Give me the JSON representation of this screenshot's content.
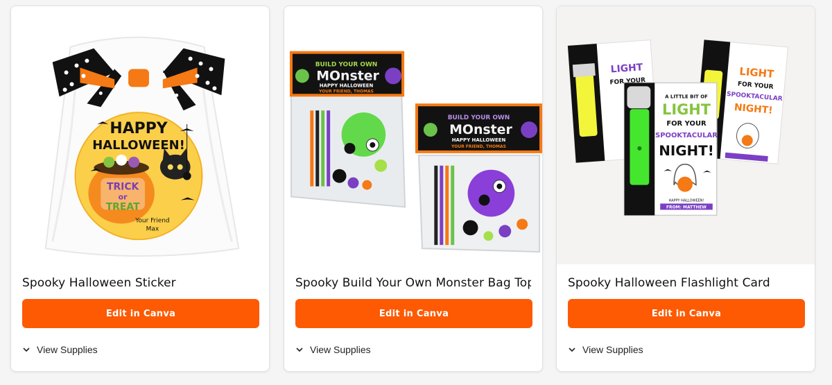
{
  "theme": {
    "accent": "#fd5a03",
    "card_bg": "#ffffff",
    "page_bg": "#f5f5f5"
  },
  "products": [
    {
      "title": "Spooky Halloween Sticker",
      "button_label": "Edit in Canva",
      "supplies_label": "View Supplies",
      "supplies_icon": "chevron-down-icon",
      "image_text": {
        "line1": "HAPPY",
        "line2": "HALLOWEEN!",
        "line3": "TRICK",
        "line4": "or",
        "line5": "TREAT",
        "line6": "Your Friend",
        "line7": "Max"
      }
    },
    {
      "title": "Spooky Build Your Own Monster Bag Topper",
      "button_label": "Edit in Canva",
      "supplies_label": "View Supplies",
      "supplies_icon": "chevron-down-icon",
      "image_text": {
        "line1": "BUILD YOUR OWN",
        "line2": "MOnster",
        "line3": "HAPPY HALLOWEEN",
        "line4": "YOUR FRIEND, THOMAS"
      }
    },
    {
      "title": "Spooky Halloween Flashlight Card",
      "button_label": "Edit in Canva",
      "supplies_label": "View Supplies",
      "supplies_icon": "chevron-down-icon",
      "image_text": {
        "line1": "A LITTLE BIT OF",
        "line2": "LIGHT",
        "line3": "FOR YOUR",
        "line4": "SPOOKTACULAR",
        "line5": "NIGHT!",
        "line6": "HAPPY HALLOWEEN!",
        "line7": "FROM: MATTHEW"
      }
    }
  ]
}
